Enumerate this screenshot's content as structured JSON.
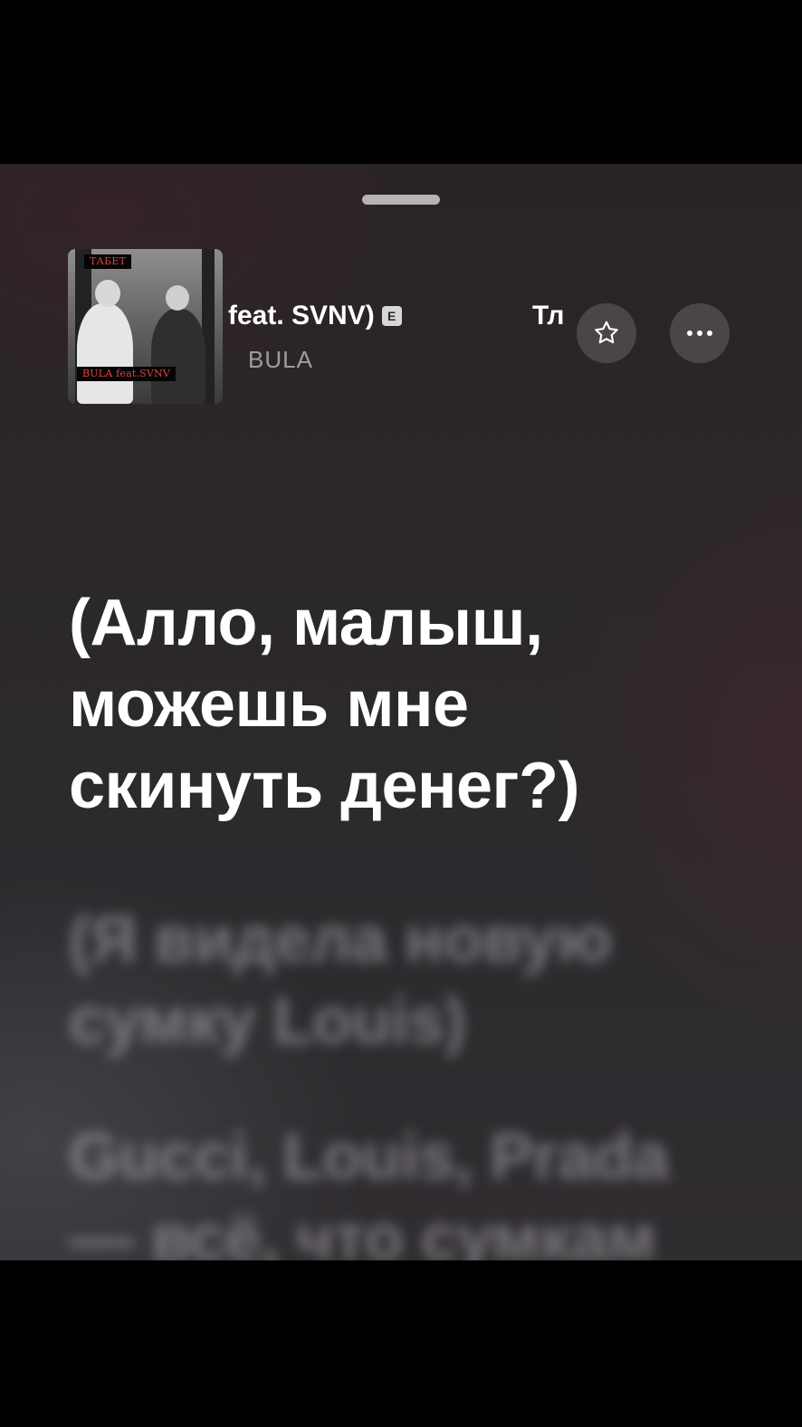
{
  "player": {
    "track_title_visible": "feat. SVNV)",
    "explicit_badge": "E",
    "next_title_visible": "Тл",
    "artist": "BULA",
    "artwork": {
      "top_tag": "ТАБЕТ",
      "bottom_tag": "BULA feat.SVNV"
    }
  },
  "buttons": {
    "favorite_icon": "star-outline-icon",
    "more_icon": "ellipsis-icon"
  },
  "lyrics": {
    "current": [
      "(Алло, малыш,",
      "можешь мне",
      "скинуть денег?)"
    ],
    "next": [
      "(Я видела новую",
      "сумку Louis)"
    ],
    "after": [
      "Gucci, Louis, Prada",
      "— всё, что сумкам"
    ]
  },
  "colors": {
    "background_top": "#2a2326",
    "background_bottom": "#302d31",
    "lyric_active": "#ffffff",
    "artist_text": "#a9a8ad"
  }
}
